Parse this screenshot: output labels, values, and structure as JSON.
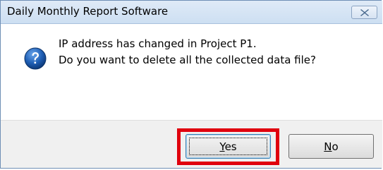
{
  "window": {
    "title": "Daily Monthly Report Software",
    "close_glyph": "✕"
  },
  "message": {
    "icon": "question-mark-icon",
    "line1": "IP address has changed in Project P1.",
    "line2": "Do you want to delete all the collected data file?"
  },
  "buttons": {
    "yes": {
      "mnemonic": "Y",
      "rest": "es"
    },
    "no": {
      "mnemonic": "N",
      "rest": "o"
    }
  },
  "colors": {
    "highlight": "#e0000e",
    "icon_blue": "#1f5fb5"
  }
}
